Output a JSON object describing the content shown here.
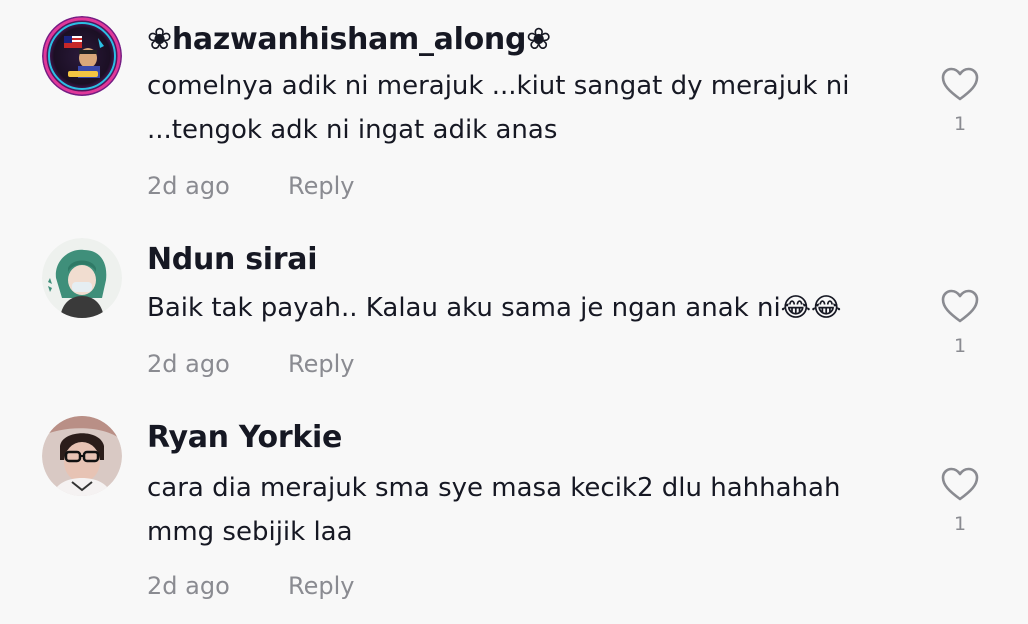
{
  "comments": [
    {
      "username": "❀hazwanhisham_along❀",
      "text": "comelnya adik ni merajuk ...kiut sangat dy merajuk ni ...tengok adk ni ingat adik anas",
      "time": "2d ago",
      "reply_label": "Reply",
      "likes": "1",
      "avatar_icon": "photo-avatar",
      "like_icon": "heart-outline-icon"
    },
    {
      "username": "Ndun sirai",
      "text": "Baik tak payah.. Kalau aku sama je ngan anak ni😂😂",
      "time": "2d ago",
      "reply_label": "Reply",
      "likes": "1",
      "avatar_icon": "anime-avatar",
      "like_icon": "heart-outline-icon"
    },
    {
      "username": "Ryan Yorkie",
      "text": "cara dia merajuk sma sye masa kecik2 dlu hahhahah mmg sebijik laa",
      "time": "2d ago",
      "reply_label": "Reply",
      "likes": "1",
      "avatar_icon": "photo-avatar",
      "like_icon": "heart-outline-icon"
    }
  ],
  "colors": {
    "background": "#f8f8f8",
    "username": "#161823",
    "text": "#161823",
    "muted": "#8a8b91"
  }
}
